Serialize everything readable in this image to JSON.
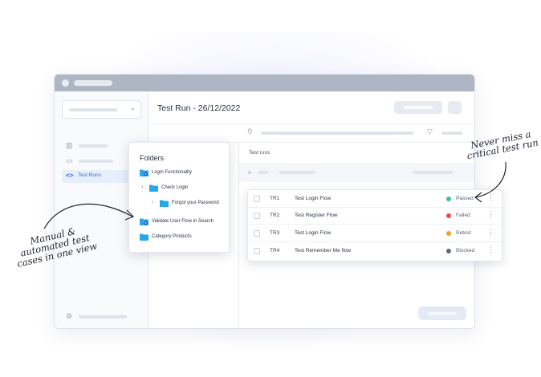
{
  "page": {
    "title": "Test Run - 26/12/2022"
  },
  "sidebar": {
    "active_item": {
      "code": "<>",
      "label": "Test Runs"
    }
  },
  "test_runs_panel": {
    "label": "Test runs",
    "rows": [
      {
        "id": "TR1",
        "title": "Test Login Flow",
        "status": "Passed",
        "color": "#3cc29a"
      },
      {
        "id": "TR2",
        "title": "Test Register Flow",
        "status": "Failed",
        "color": "#e84b4b"
      },
      {
        "id": "TR3",
        "title": "Test Login Flow",
        "status": "Retest",
        "color": "#f0a21f"
      },
      {
        "id": "TR4",
        "title": "Test Remember Me flow",
        "status": "Blocked",
        "color": "#616979"
      }
    ]
  },
  "folders": {
    "title": "Folders",
    "items": [
      {
        "label": "Login Functionality",
        "icon": "folder-gear-icon"
      },
      {
        "label": "Check Login",
        "icon": "folder-icon"
      },
      {
        "label": "Forgot your Password",
        "icon": "folder-icon"
      },
      {
        "label": "Validate User Flow in Search",
        "icon": "folder-gear-icon"
      },
      {
        "label": "Category Products",
        "icon": "folder-icon"
      }
    ]
  },
  "annotations": {
    "left": [
      "Manual &",
      "automated test",
      "cases in one view"
    ],
    "right": [
      "Never miss a",
      "critical test run"
    ]
  },
  "colors": {
    "accent": "#2f6fe0",
    "folder": "#29a6e8"
  }
}
